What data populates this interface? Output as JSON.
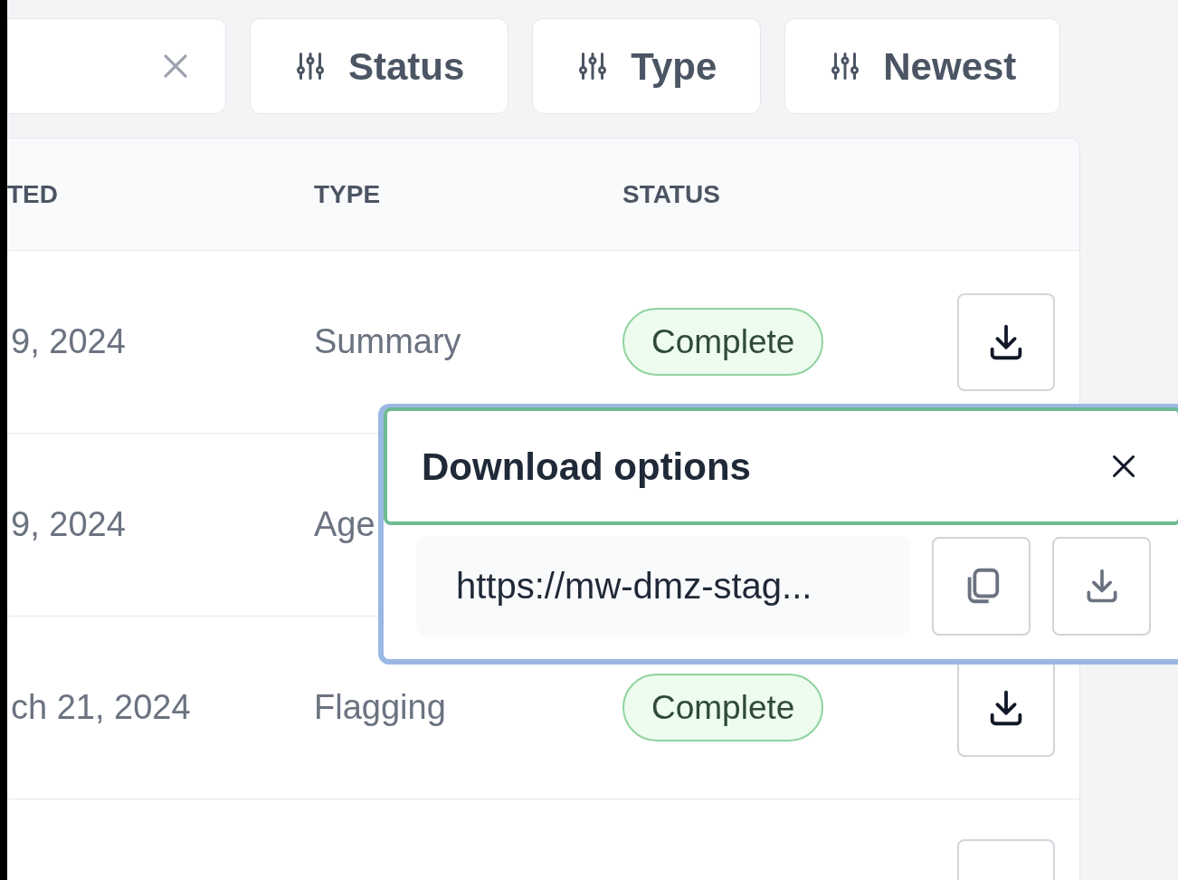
{
  "filters": [
    {
      "label": "Status"
    },
    {
      "label": "Type"
    },
    {
      "label": "Newest"
    }
  ],
  "table": {
    "columns": [
      "TED",
      "TYPE",
      "STATUS"
    ],
    "rows": [
      {
        "kind": "full",
        "date": "9, 2024",
        "type": "Summary",
        "status": "Complete"
      },
      {
        "kind": "covered",
        "date": "9, 2024",
        "type": "Age"
      },
      {
        "kind": "full",
        "date": "ch 21, 2024",
        "type": "Flagging",
        "status": "Complete"
      },
      {
        "kind": "cut"
      }
    ]
  },
  "popover": {
    "title": "Download options",
    "url": "https://mw-dmz-stag..."
  }
}
